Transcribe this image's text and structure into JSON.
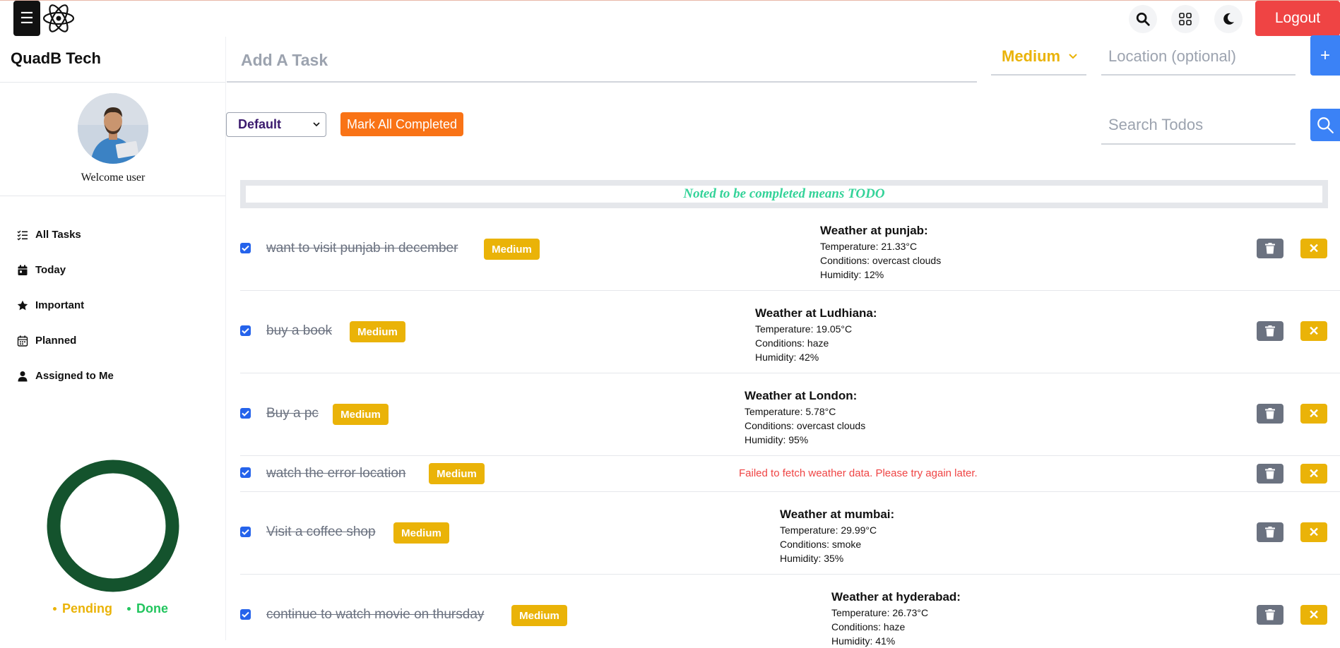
{
  "header": {
    "menu_icon": "hamburger-icon",
    "logo_icon": "react-atom-icon",
    "logout_label": "Logout"
  },
  "sidebar": {
    "brand": "QuadB Tech",
    "welcome": "Welcome user",
    "items": [
      {
        "label": "All Tasks",
        "icon": "list-check-icon"
      },
      {
        "label": "Today",
        "icon": "calendar-day-icon"
      },
      {
        "label": "Important",
        "icon": "star-icon"
      },
      {
        "label": "Planned",
        "icon": "calendar-icon"
      },
      {
        "label": "Assigned to Me",
        "icon": "user-icon"
      }
    ],
    "legend": {
      "pending": "Pending",
      "done": "Done"
    },
    "colors": {
      "pending": "#eab308",
      "done": "#22c55e",
      "ring": "#14532d"
    }
  },
  "add_task": {
    "placeholder": "Add A Task",
    "priority": "Medium",
    "location_placeholder": "Location (optional)",
    "add_label": "+"
  },
  "toolbar": {
    "filter": "Default",
    "mark_all": "Mark All Completed",
    "search_placeholder": "Search Todos"
  },
  "note": "Noted to be completed means TODO",
  "todos": [
    {
      "text": "want to visit punjab in december",
      "priority": "Medium",
      "weather": {
        "title": "Weather at punjab:",
        "temp": "Temperature: 21.33°C",
        "cond": "Conditions: overcast clouds",
        "hum": "Humidity: 12%"
      }
    },
    {
      "text": "buy a book",
      "priority": "Medium",
      "weather": {
        "title": "Weather at Ludhiana:",
        "temp": "Temperature: 19.05°C",
        "cond": "Conditions: haze",
        "hum": "Humidity: 42%"
      }
    },
    {
      "text": "Buy a pc",
      "priority": "Medium",
      "weather": {
        "title": "Weather at London:",
        "temp": "Temperature: 5.78°C",
        "cond": "Conditions: overcast clouds",
        "hum": "Humidity: 95%"
      }
    },
    {
      "text": "watch the error location",
      "priority": "Medium",
      "error": "Failed to fetch weather data. Please try again later."
    },
    {
      "text": "Visit a coffee shop",
      "priority": "Medium",
      "weather": {
        "title": "Weather at mumbai:",
        "temp": "Temperature: 29.99°C",
        "cond": "Conditions: smoke",
        "hum": "Humidity: 35%"
      }
    },
    {
      "text": "continue to watch movie on thursday",
      "priority": "Medium",
      "weather": {
        "title": "Weather at hyderabad:",
        "temp": "Temperature: 26.73°C",
        "cond": "Conditions: haze",
        "hum": "Humidity: 41%"
      }
    }
  ]
}
